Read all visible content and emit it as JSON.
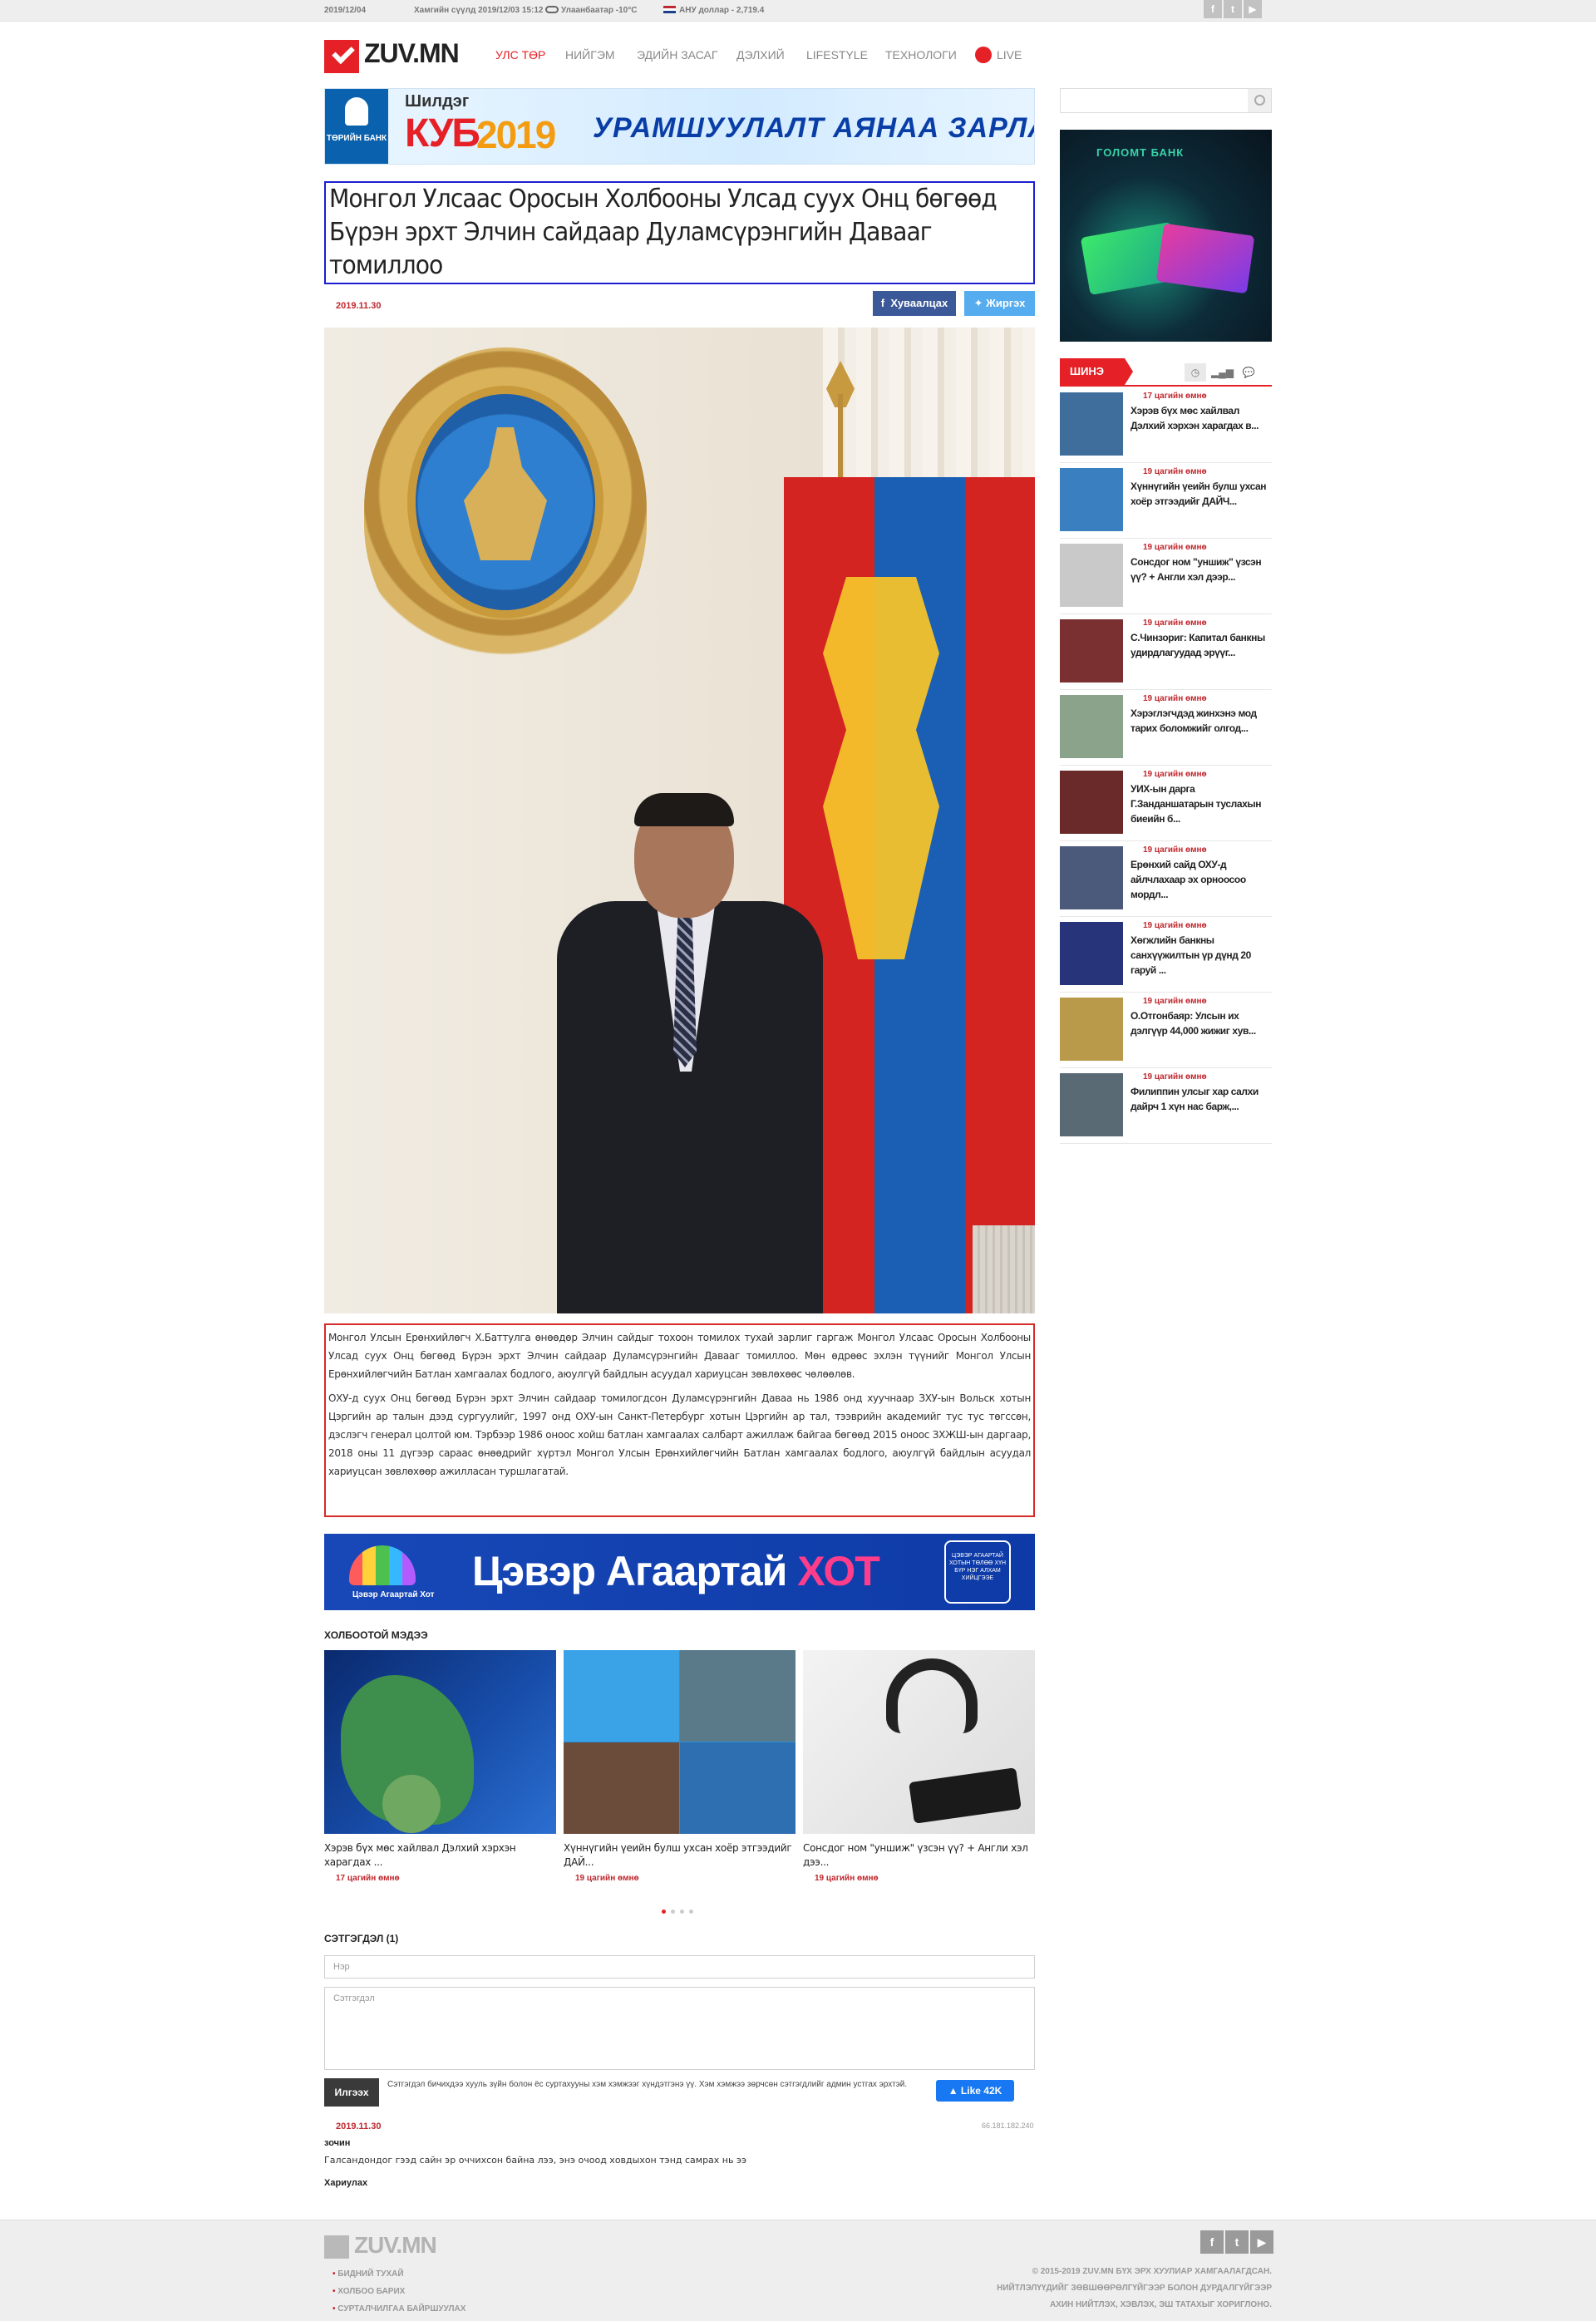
{
  "topbar": {
    "date": "2019/12/04",
    "last_update": "Хамгийн сүүлд 2019/12/03 15:12",
    "weather": "Улаанбаатар -10°C",
    "currency": "АНУ доллар - 2,719.4",
    "social": [
      "f",
      "t",
      "▶"
    ]
  },
  "header": {
    "logo": "ZUV.MN",
    "nav": [
      "УЛС ТӨР",
      "НИЙГЭМ",
      "ЭДИЙН ЗАСАГ",
      "ДЭЛХИЙ",
      "LIFESTYLE",
      "ТЕХНОЛОГИ",
      "LIVE"
    ]
  },
  "banner_top": {
    "bank": "ТӨРИЙН БАНК",
    "line1": "Шилдэг",
    "line2": "КУБ",
    "line3": "2019",
    "message": "УРАМШУУЛАЛТ АЯНАА ЗАРЛАЛАА"
  },
  "article": {
    "title": "Монгол Улсаас Оросын Холбооны Улсад суух Онц бөгөөд Бүрэн эрхт Элчин сайдаар Дуламсүрэнгийн Давааг томиллоо",
    "date": "2019.11.30",
    "share_fb": "Хуваалцах",
    "share_tw": "Жиргэх",
    "paragraphs": [
      "Монгол Улсын Ерөнхийлөгч Х.Баттулга өнөөдөр Элчин сайдыг тохоон томилох тухай зарлиг гаргаж Монгол Улсаас Оросын Холбооны Улсад суух Онц бөгөөд Бүрэн эрхт Элчин сайдаар Дуламсүрэнгийн Давааг томиллоо. Мөн өдрөөс эхлэн түүнийг Монгол Улсын Ерөнхийлөгчийн Батлан хамгаалах бодлого, аюулгүй байдлын асуудал хариуцсан зөвлөхөөс чөлөөлөв.",
      "ОХУ-д суух Онц бөгөөд Бүрэн эрхт Элчин сайдаар томилогдсон Дуламсүрэнгийн Даваа нь 1986 онд хуучнаар ЗХУ-ын Вольск хотын Цэргийн ар талын дээд сургуулийг, 1997 онд ОХУ-ын Санкт-Петербург хотын Цэргийн ар тал, тээврийн академийг тус тус төгссөн, дэслэгч генерал цолтой юм. Тэрбээр 1986 оноос хойш батлан хамгаалах салбарт ажиллаж байгаа бөгөөд 2015 оноос ЗХЖШ-ын даргаар, 2018 оны 11 дүгээр сараас өнөөдрийг хүртэл Монгол Улсын Ерөнхийлөгчийн Батлан хамгаалах бодлого, аюулгүй байдлын асуудал хариуцсан зөвлөхөөр ажилласан туршлагатай."
    ]
  },
  "banner_mid": {
    "city_label": "Цэвэр Агаартай Хот",
    "text": "Цэвэр Агаартай ",
    "hot": "ХОТ",
    "tag": "ЦЭВЭР АГААРТАЙ ХОТЫН ТӨЛӨӨ ХҮН БҮР НЭГ АЛХАМ ХИЙЦГЭЭЕ"
  },
  "related": {
    "heading": "ХОЛБООТОЙ МЭДЭЭ",
    "items": [
      {
        "title": "Хэрэв бүх мөс хайлвал Дэлхий хэрхэн харагдах ...",
        "time": "17 цагийн өмнө"
      },
      {
        "title": "Хүннүгийн үеийн булш ухсан хоёр этгээдийг ДАЙ...",
        "time": "19 цагийн өмнө"
      },
      {
        "title": "Сонсдог ном \"уншиж\" үзсэн үү? + Англи хэл дээ...",
        "time": "19 цагийн өмнө"
      }
    ]
  },
  "comments": {
    "heading": "СЭТГЭГДЭЛ (1)",
    "name_placeholder": "Нэр",
    "text_placeholder": "Сэтгэгдэл",
    "send": "Илгээх",
    "note": "Сэтгэгдэл бичихдээ хууль зүйн болон ёс суртахууны хэм хэмжээг хүндэтгэнэ үү. Хэм хэмжээ зөрчсөн сэтгэгдлийг админ устгах эрхтэй.",
    "like": "Like 42K",
    "items": [
      {
        "date": "2019.11.30",
        "ip": "66.181.182.240",
        "name": "зочин",
        "text": "Галсандондог гээд сайн эр оччихсон байна лээ, энэ очоод ховдыхон тэнд самрах нь ээ",
        "reply": "Хариулах"
      }
    ]
  },
  "sidebar": {
    "search_placeholder": "",
    "ad_brand": "ГОЛОМТ БАНК",
    "tab_label": "ШИНЭ",
    "tab_icons": [
      "◷",
      "▂▄▆",
      "💬"
    ],
    "items": [
      {
        "time": "17 цагийн өмнө",
        "title": "Хэрэв бүх мөс хайлвал Дэлхий хэрхэн харагдах в..."
      },
      {
        "time": "19 цагийн өмнө",
        "title": "Хүннүгийн үеийн булш ухсан хоёр этгээдийг ДАЙЧ..."
      },
      {
        "time": "19 цагийн өмнө",
        "title": "Сонсдог ном \"уншиж\" үзсэн үү? + Англи хэл дээр..."
      },
      {
        "time": "19 цагийн өмнө",
        "title": "С.Чинзориг: Капитал банкны удирдлагуудад эрүүг..."
      },
      {
        "time": "19 цагийн өмнө",
        "title": "Хэрэглэгчдэд жинхэнэ мод тарих боломжийг олгод..."
      },
      {
        "time": "19 цагийн өмнө",
        "title": "УИХ-ын дарга Г.Занданшатарын туслахын биеийн б..."
      },
      {
        "time": "19 цагийн өмнө",
        "title": "Ерөнхий сайд ОХУ-д айлчлахаар эх орноосоо мордл..."
      },
      {
        "time": "19 цагийн өмнө",
        "title": "Хөгжлийн банкны санхүүжилтын үр дүнд 20 гаруй ..."
      },
      {
        "time": "19 цагийн өмнө",
        "title": "О.Отгонбаяр: Улсын их дэлгүүр 44,000 жижиг хув..."
      },
      {
        "time": "19 цагийн өмнө",
        "title": "Филиппин улсыг хар салхи дайрч 1 хүн нас барж,..."
      }
    ]
  },
  "footer": {
    "logo": "ZUV.MN",
    "links": [
      "БИДНИЙ ТУХАЙ",
      "ХОЛБОО БАРИХ",
      "СУРТАЛЧИЛГАА БАЙРШУУЛАХ"
    ],
    "copyright": [
      "© 2015-2019 ZUV.MN БҮХ ЭРХ ХУУЛИАР ХАМГААЛАГДСАН.",
      "НИЙТЛЭЛҮҮДИЙГ ЗӨВШӨӨРӨЛГҮЙГЭЭР БОЛОН ДУРДАЛГҮЙГЭЭР",
      "АХИН НИЙТЛЭХ, ХЭВЛЭХ, ЭШ ТАТАХЫГ ХОРИГЛОНО."
    ],
    "social": [
      "f",
      "t",
      "▶"
    ]
  }
}
